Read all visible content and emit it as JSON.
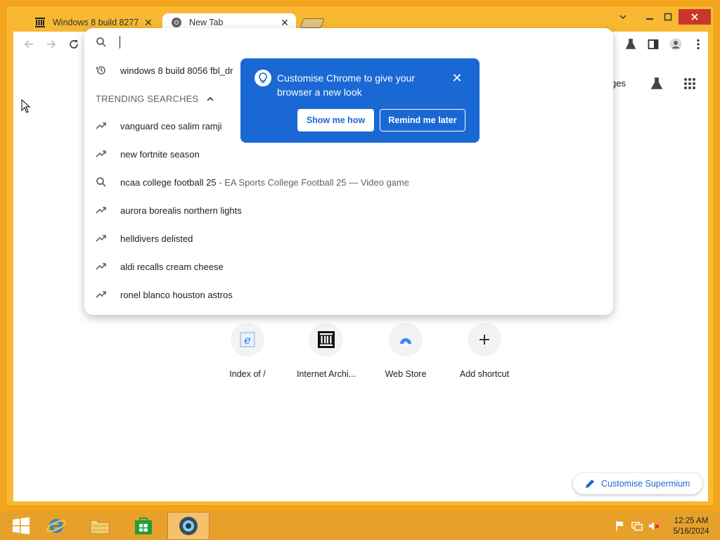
{
  "tabs": [
    {
      "label": "Windows 8 build 8277",
      "icon": "internet-archive-icon"
    },
    {
      "label": "New Tab",
      "icon": "chromium-icon"
    }
  ],
  "omnibox": {
    "history_item": "windows 8 build 8056 fbl_dr",
    "trending_header": "TRENDING SEARCHES",
    "suggestions": [
      {
        "text": "vanguard ceo salim ramji",
        "sub": "",
        "icon": "trending-icon"
      },
      {
        "text": "new fortnite season",
        "sub": "",
        "icon": "trending-icon"
      },
      {
        "text": "ncaa college football 25",
        "sub": " - EA Sports College Football 25 — Video game",
        "icon": "search-icon"
      },
      {
        "text": "aurora borealis northern lights",
        "sub": "",
        "icon": "trending-icon"
      },
      {
        "text": "helldivers delisted",
        "sub": "",
        "icon": "trending-icon"
      },
      {
        "text": "aldi recalls cream cheese",
        "sub": "",
        "icon": "trending-icon"
      },
      {
        "text": "ronel blanco houston astros",
        "sub": "",
        "icon": "trending-icon"
      }
    ]
  },
  "promo": {
    "text": "Customise Chrome to give your browser a new look",
    "primary": "Show me how",
    "secondary": "Remind me later"
  },
  "ntp": {
    "images_link": "ges",
    "customise_label": "Customise Supermium",
    "shortcuts": [
      {
        "label": "Index of /",
        "icon": "ie-icon"
      },
      {
        "label": "Internet Archi...",
        "icon": "internet-archive-icon"
      },
      {
        "label": "Web Store",
        "icon": "web-store-icon"
      },
      {
        "label": "Add shortcut",
        "icon": "plus-icon"
      }
    ]
  },
  "taskbar": {
    "time": "12:25 AM",
    "date": "5/16/2024"
  },
  "colors": {
    "accent": "#1a68d4",
    "desktop": "#f3a31c",
    "frame": "#f8b832"
  }
}
